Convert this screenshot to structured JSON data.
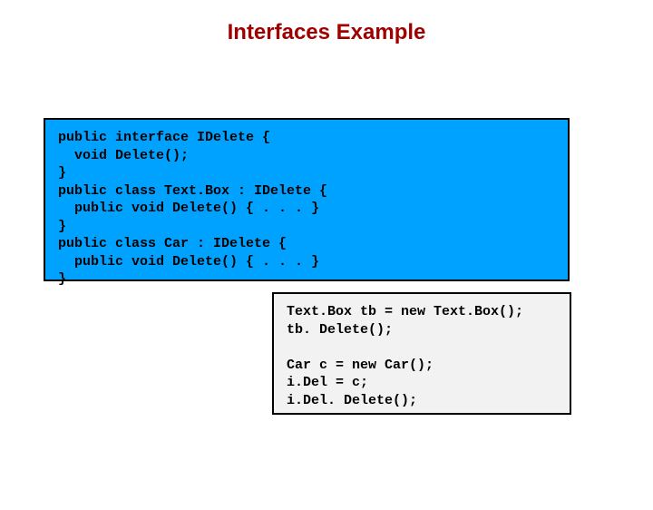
{
  "title": "Interfaces Example",
  "code1": "public interface IDelete {\n  void Delete();\n}\npublic class Text.Box : IDelete {\n  public void Delete() { . . . }\n}\npublic class Car : IDelete {\n  public void Delete() { . . . }\n}",
  "code2": "Text.Box tb = new Text.Box();\ntb. Delete();\n\nCar c = new Car();\ni.Del = c;\ni.Del. Delete();"
}
